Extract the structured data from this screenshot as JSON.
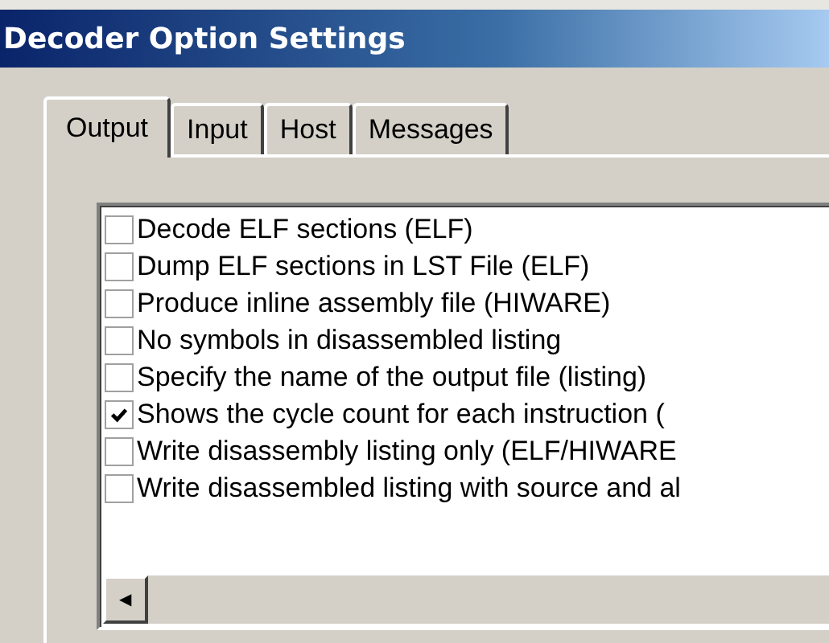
{
  "window": {
    "title": "Decoder Option Settings"
  },
  "tabs": [
    {
      "label": "Output",
      "selected": true
    },
    {
      "label": "Input",
      "selected": false
    },
    {
      "label": "Host",
      "selected": false
    },
    {
      "label": "Messages",
      "selected": false
    }
  ],
  "options": [
    {
      "label": "Decode ELF sections (ELF)",
      "checked": false
    },
    {
      "label": "Dump ELF sections in LST File (ELF)",
      "checked": false
    },
    {
      "label": "Produce inline assembly file (HIWARE)",
      "checked": false
    },
    {
      "label": "No symbols in disassembled listing",
      "checked": false
    },
    {
      "label": "Specify the name of the output file (listing)",
      "checked": false
    },
    {
      "label": "Shows the cycle count for each instruction (",
      "checked": true
    },
    {
      "label": "Write disassembly listing only (ELF/HIWARE",
      "checked": false
    },
    {
      "label": "Write disassembled listing with source and al",
      "checked": false
    }
  ],
  "scrollbar": {
    "left_arrow": "◀"
  }
}
